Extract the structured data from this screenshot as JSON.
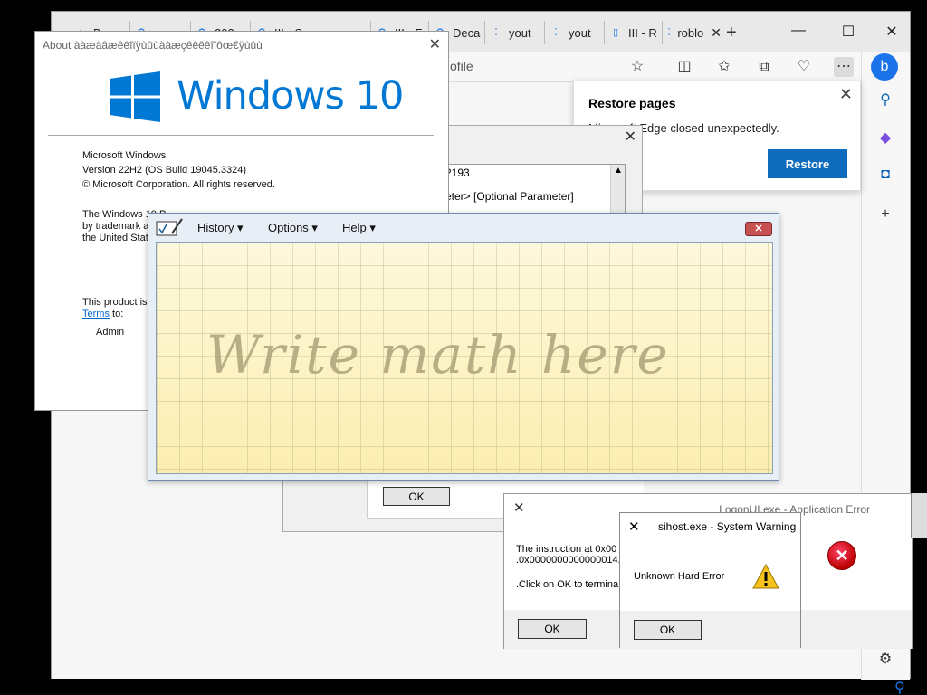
{
  "browser": {
    "tabs": [
      {
        "label": "De",
        "icon": "edge-tab-icon"
      },
      {
        "label": "",
        "icon": "gear-icon"
      },
      {
        "label": "202",
        "icon": "gear-icon"
      },
      {
        "label": "III - S",
        "icon": "gear-icon"
      },
      {
        "label": "III - F",
        "icon": "gear-icon"
      },
      {
        "label": "Deca",
        "icon": "gear-icon"
      },
      {
        "label": "yout",
        "icon": "loading-icon"
      },
      {
        "label": "yout",
        "icon": "loading-icon"
      },
      {
        "label": "III - R",
        "icon": "page-icon"
      },
      {
        "label": "roblo",
        "icon": "loading-icon"
      }
    ],
    "address_fragment": "ofile",
    "restore": {
      "title": "Restore pages",
      "message": "Microsoft Edge closed unexpectedly.",
      "button": "Restore"
    }
  },
  "about": {
    "title": "About ààæàâæêêîïÿùûùààæçêêêêîïôœ€ÿùûù",
    "brand": "Windows 10",
    "lines": [
      "Microsoft Windows",
      "Version 22H2 (OS Build 19045.3324)",
      "© Microsoft Corporation. All rights reserved.",
      "The Windows 10 P",
      "by trademark a",
      "the United Stat",
      "This product is",
      "to:",
      "Admin"
    ],
    "terms_link": "Terms",
    "accent_color": "#0078d4"
  },
  "cmd_dialog": {
    "lines": [
      "2193",
      "eter> [Optional Parameter]"
    ],
    "ok_label": "OK"
  },
  "math_panel": {
    "menus": [
      "History ▾",
      "Options ▾",
      "Help ▾"
    ],
    "placeholder": "Write math here"
  },
  "logon_error": {
    "title": "LogonUI.exe - Application Error",
    "lines": [
      "The instruction at 0x00",
      ".0x0000000000000014.",
      ".Click on OK to termina"
    ],
    "ok_label": "OK"
  },
  "sihost_warning": {
    "title": "sihost.exe - System Warning",
    "message": "Unknown Hard Error",
    "ok_label": "OK"
  }
}
